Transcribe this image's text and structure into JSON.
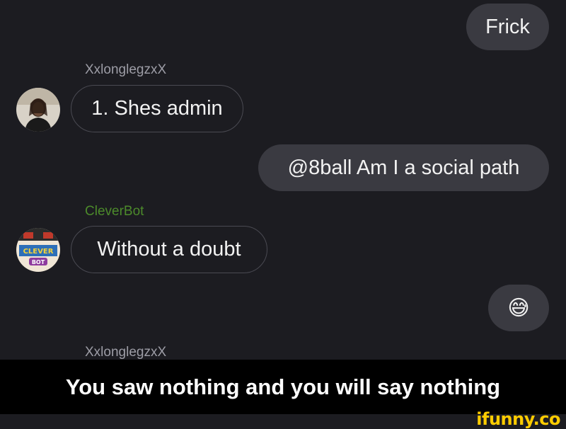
{
  "messages": {
    "out_1": "Frick",
    "user_1": "XxlonglegzxX",
    "in_1": "1. Shes admin",
    "out_2": "@8ball Am I a social path",
    "user_2": "CleverBot",
    "in_2": "Without a doubt",
    "out_3_emoji": "😅",
    "user_3": "XxlonglegzxX"
  },
  "caption": "You saw nothing and you will say nothing",
  "watermark": "ifunny.co",
  "colors": {
    "background": "#1c1c21",
    "outgoing_bubble": "#3a3a41",
    "incoming_border": "#4a4a52",
    "username": "#9d9da6",
    "bot_username": "#4c8a2b",
    "watermark": "#ffcc00"
  }
}
